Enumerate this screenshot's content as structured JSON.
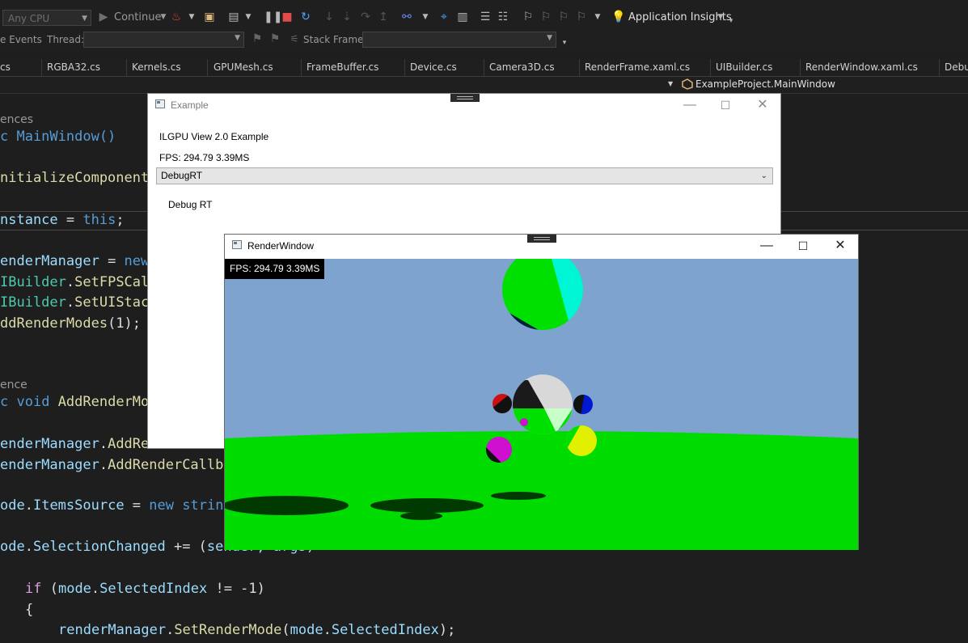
{
  "ide": {
    "toolbar": {
      "platform": "Any CPU",
      "continue_label": "Continue",
      "app_insights": "Application Insights"
    },
    "debugbar": {
      "events_label": "e Events",
      "thread_label": "Thread:",
      "stack_frame_label": "Stack Frame:"
    },
    "tabs": [
      "cs",
      "RGBA32.cs",
      "Kernels.cs",
      "GPUMesh.cs",
      "FrameBuffer.cs",
      "Device.cs",
      "Camera3D.cs",
      "RenderFrame.xaml.cs",
      "UIBuilder.cs",
      "RenderWindow.xaml.cs",
      "Debu"
    ],
    "nav_member": "ExampleProject.MainWindow",
    "code": {
      "ref1": "ences",
      "l1": "c MainWindow()",
      "l2": "nitializeComponent",
      "l3a": "nstance",
      "l3b": " = ",
      "l3c": "this",
      "l3d": ";",
      "l4a": "enderManager",
      "l4b": " = ",
      "l4c": "new",
      "l5a": "IBuilder",
      "l5b": ".",
      "l5c": "SetFPSCal",
      "l6a": "IBuilder",
      "l6b": ".",
      "l6c": "SetUIStac",
      "l7a": "ddRenderModes",
      "l7b": "(1);",
      "ref2": "ence",
      "l8a": "c ",
      "l8b": "void",
      "l8c": "AddRenderMo",
      "l9a": "enderManager",
      "l9b": ".",
      "l9c": "AddRe",
      "l10a": "enderManager",
      "l10b": ".",
      "l10c": "AddRenderCallb",
      "l11a": "ode",
      "l11b": ".",
      "l11c": "ItemsSource",
      "l11d": " = ",
      "l11e": "new",
      "l11f": "strin",
      "l12a": "ode",
      "l12b": ".",
      "l12c": "SelectionChanged",
      "l12d": " += (",
      "l12e": "sender, args",
      "l12f": ") =>",
      "l13a": "if",
      "l13b": " (",
      "l13c": "mode",
      "l13d": ".",
      "l13e": "SelectedIndex",
      "l13f": " != -1)",
      "l14": "{",
      "l15a": "renderManager",
      "l15b": ".",
      "l15c": "SetRenderMode",
      "l15d": "(",
      "l15e": "mode",
      "l15f": ".",
      "l15g": "SelectedIndex",
      "l15h": ");"
    }
  },
  "example_window": {
    "title": "Example",
    "heading": "ILGPU View 2.0 Example",
    "fps": "FPS: 294.79 3.39MS",
    "mode_selected": "DebugRT",
    "mode_label": "Debug RT"
  },
  "render_window": {
    "title": "RenderWindow",
    "fps_overlay": "FPS: 294.79 3.39MS"
  },
  "colors": {
    "sky": "#7fa3cf",
    "ground": "#00dc00",
    "ide_bg": "#1e1e1e"
  }
}
